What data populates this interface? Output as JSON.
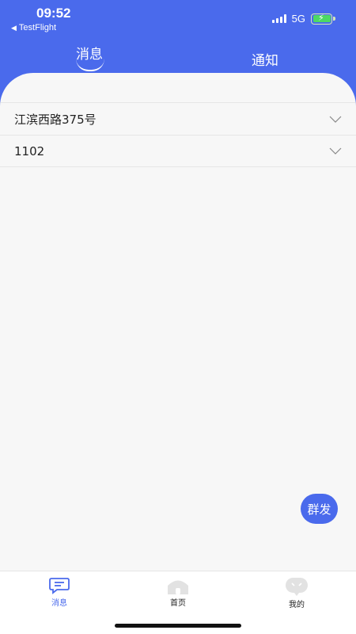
{
  "status_bar": {
    "time": "09:52",
    "back_app": "TestFlight",
    "network": "5G"
  },
  "top_tabs": [
    {
      "label": "消息",
      "active": true
    },
    {
      "label": "通知",
      "active": false
    }
  ],
  "list": {
    "items": [
      {
        "label": "江滨西路375号"
      },
      {
        "label": "1102"
      }
    ]
  },
  "fab": {
    "label": "群发"
  },
  "bottom_tabs": [
    {
      "label": "消息",
      "icon": "message-icon",
      "active": true
    },
    {
      "label": "首页",
      "icon": "home-icon",
      "active": false
    },
    {
      "label": "我的",
      "icon": "profile-icon",
      "active": false
    }
  ],
  "colors": {
    "accent": "#4a6aec",
    "background": "#f7f7f7"
  }
}
